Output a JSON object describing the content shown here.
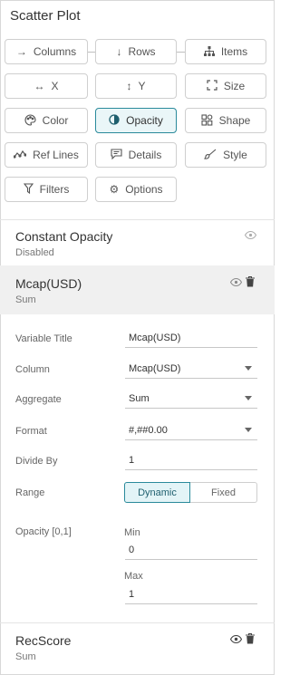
{
  "panel": {
    "title": "Scatter Plot"
  },
  "buttons": {
    "columns": "Columns",
    "rows": "Rows",
    "items": "Items",
    "x": "X",
    "y": "Y",
    "size": "Size",
    "color": "Color",
    "opacity": "Opacity",
    "shape": "Shape",
    "ref_lines": "Ref Lines",
    "details": "Details",
    "style": "Style",
    "filters": "Filters",
    "options": "Options"
  },
  "active_button": "opacity",
  "constant_opacity": {
    "title": "Constant Opacity",
    "status": "Disabled"
  },
  "variable": {
    "name": "Mcap(USD)",
    "aggregate_label": "Sum",
    "fields": {
      "variable_title_label": "Variable Title",
      "variable_title_value": "Mcap(USD)",
      "column_label": "Column",
      "column_value": "Mcap(USD)",
      "aggregate_label": "Aggregate",
      "aggregate_value": "Sum",
      "format_label": "Format",
      "format_value": "#,##0.00",
      "divide_by_label": "Divide By",
      "divide_by_value": "1",
      "range_label": "Range",
      "range_dynamic": "Dynamic",
      "range_fixed": "Fixed",
      "opacity_label": "Opacity [0,1]",
      "min_label": "Min",
      "min_value": "0",
      "max_label": "Max",
      "max_value": "1"
    }
  },
  "next_variable": {
    "name": "RecScore",
    "aggregate_label": "Sum"
  },
  "colors": {
    "accent": "#2a8a9b",
    "active_bg": "#eaf6f8",
    "band": "#f0f0f0"
  }
}
